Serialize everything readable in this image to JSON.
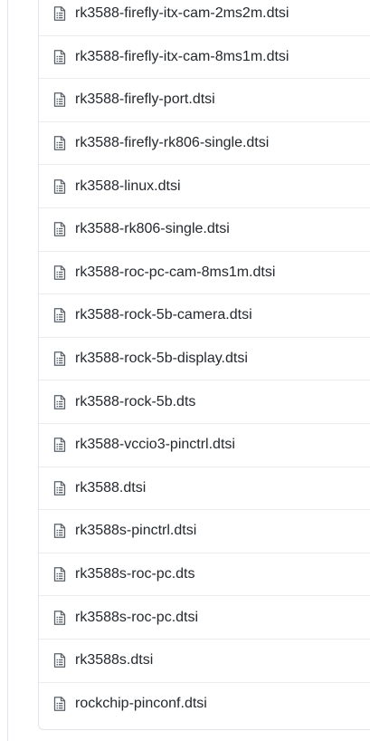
{
  "file_browser": {
    "icon": "file-text-icon",
    "files": [
      "rk3588-firefly-itx-cam-2ms2m.dtsi",
      "rk3588-firefly-itx-cam-8ms1m.dtsi",
      "rk3588-firefly-port.dtsi",
      "rk3588-firefly-rk806-single.dtsi",
      "rk3588-linux.dtsi",
      "rk3588-rk806-single.dtsi",
      "rk3588-roc-pc-cam-8ms1m.dtsi",
      "rk3588-rock-5b-camera.dtsi",
      "rk3588-rock-5b-display.dtsi",
      "rk3588-rock-5b.dts",
      "rk3588-vccio3-pinctrl.dtsi",
      "rk3588.dtsi",
      "rk3588s-pinctrl.dtsi",
      "rk3588s-roc-pc.dts",
      "rk3588s-roc-pc.dtsi",
      "rk3588s.dtsi",
      "rockchip-pinconf.dtsi"
    ]
  },
  "colors": {
    "text": "#24292e",
    "icon": "#586069",
    "border": "#e1e4e8",
    "link_hover": "#0366d6"
  }
}
